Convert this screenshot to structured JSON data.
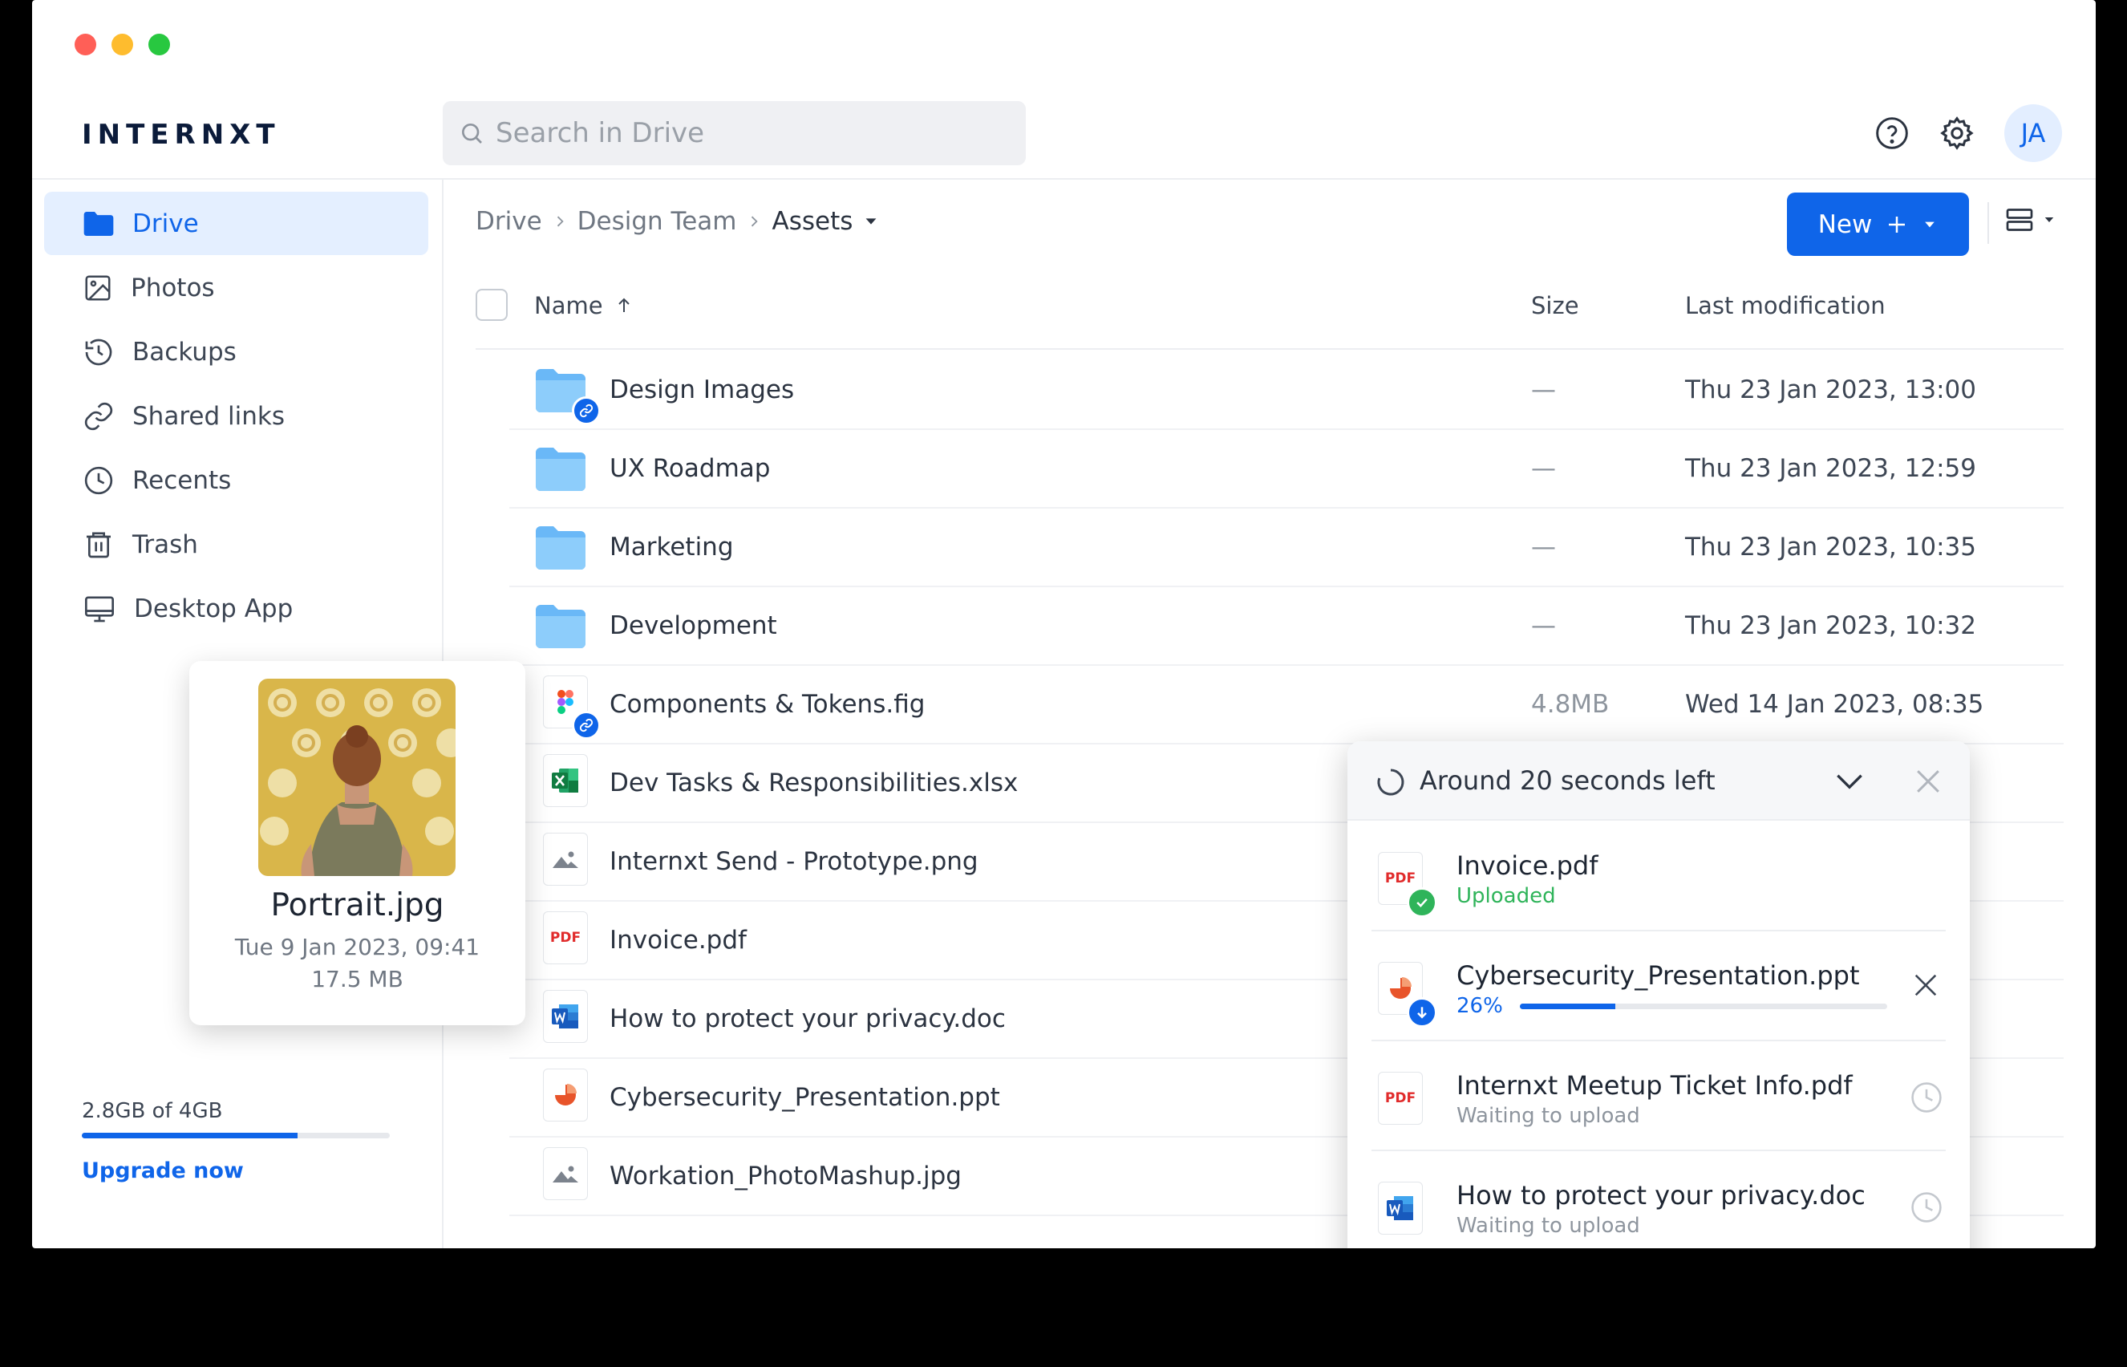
{
  "window": {
    "colors": {
      "close": "#ff5f57",
      "minimize": "#febc2e",
      "zoom": "#28c840"
    }
  },
  "header": {
    "logo": "INTERNXT",
    "search_placeholder": "Search in Drive",
    "avatar_initials": "JA",
    "icons": [
      "help-icon",
      "gear-icon"
    ]
  },
  "sidebar": {
    "items": [
      {
        "label": "Drive",
        "icon": "folder-icon",
        "active": true
      },
      {
        "label": "Photos",
        "icon": "photo-icon"
      },
      {
        "label": "Backups",
        "icon": "history-icon"
      },
      {
        "label": "Shared links",
        "icon": "link-icon"
      },
      {
        "label": "Recents",
        "icon": "clock-icon"
      },
      {
        "label": "Trash",
        "icon": "trash-icon"
      },
      {
        "label": "Desktop App",
        "icon": "desktop-icon"
      }
    ],
    "storage_text": "2.8GB of 4GB",
    "storage_used_fraction": 0.7,
    "upgrade_label": "Upgrade now"
  },
  "breadcrumb": {
    "items": [
      "Drive",
      "Design Team",
      "Assets"
    ]
  },
  "toolbar": {
    "new_label": "New"
  },
  "table": {
    "columns": {
      "name": "Name",
      "size": "Size",
      "modified": "Last modification"
    },
    "rows": [
      {
        "name": "Design Images",
        "type": "folder",
        "shared": true,
        "size": "—",
        "modified": "Thu 23 Jan 2023, 13:00"
      },
      {
        "name": "UX Roadmap",
        "type": "folder",
        "size": "—",
        "modified": "Thu 23 Jan 2023, 12:59"
      },
      {
        "name": "Marketing",
        "type": "folder",
        "size": "—",
        "modified": "Thu 23 Jan 2023, 10:35"
      },
      {
        "name": "Development",
        "type": "folder",
        "size": "—",
        "modified": "Thu 23 Jan 2023, 10:32"
      },
      {
        "name": "Components & Tokens.fig",
        "type": "figma",
        "shared": true,
        "size": "4.8MB",
        "modified": "Wed 14 Jan 2023, 08:35"
      },
      {
        "name": "Dev Tasks & Responsibilities.xlsx",
        "type": "excel"
      },
      {
        "name": "Internxt Send - Prototype.png",
        "type": "image"
      },
      {
        "name": "Invoice.pdf",
        "type": "pdf"
      },
      {
        "name": "How to protect your privacy.doc",
        "type": "word"
      },
      {
        "name": "Cybersecurity_Presentation.ppt",
        "type": "ppt"
      },
      {
        "name": "Workation_PhotoMashup.jpg",
        "type": "image"
      }
    ]
  },
  "preview": {
    "name": "Portrait.jpg",
    "date": "Tue 9 Jan 2023, 09:41",
    "size": "17.5 MB"
  },
  "upload_panel": {
    "title": "Around 20 seconds left",
    "items": [
      {
        "name": "Invoice.pdf",
        "status": "Uploaded",
        "type": "pdf",
        "state": "done"
      },
      {
        "name": "Cybersecurity_Presentation.ppt",
        "status": "26%",
        "type": "ppt",
        "state": "uploading",
        "progress": 0.26
      },
      {
        "name": "Internxt Meetup Ticket Info.pdf",
        "status": "Waiting to upload",
        "type": "pdf",
        "state": "waiting"
      },
      {
        "name": "How to protect your privacy.doc",
        "status": "Waiting to upload",
        "type": "word",
        "state": "waiting"
      }
    ]
  },
  "file_icon_text": {
    "pdf": "PDF"
  }
}
